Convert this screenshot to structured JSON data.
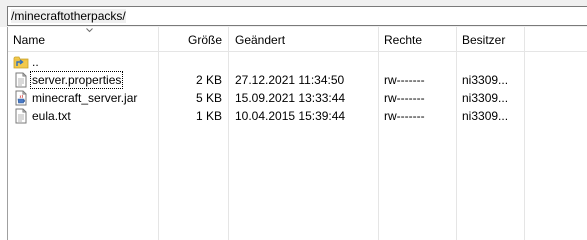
{
  "path": {
    "value": "/minecraftotherpacks/"
  },
  "columns": {
    "name": "Name",
    "size": "Größe",
    "modified": "Geändert",
    "rights": "Rechte",
    "owner": "Besitzer"
  },
  "rows": [
    {
      "name": "..",
      "icon": "folder-up-icon",
      "size": "",
      "modified": "",
      "rights": "",
      "owner": ""
    },
    {
      "name": "server.properties",
      "icon": "text-file-icon",
      "size": "2 KB",
      "modified": "27.12.2021 11:34:50",
      "rights": "rw-------",
      "owner": "ni3309..."
    },
    {
      "name": "minecraft_server.jar",
      "icon": "java-file-icon",
      "size": "5 KB",
      "modified": "15.09.2021 13:33:44",
      "rights": "rw-------",
      "owner": "ni3309..."
    },
    {
      "name": "eula.txt",
      "icon": "text-file-icon",
      "size": "1 KB",
      "modified": "10.04.2015 15:39:44",
      "rights": "rw-------",
      "owner": "ni3309..."
    }
  ]
}
